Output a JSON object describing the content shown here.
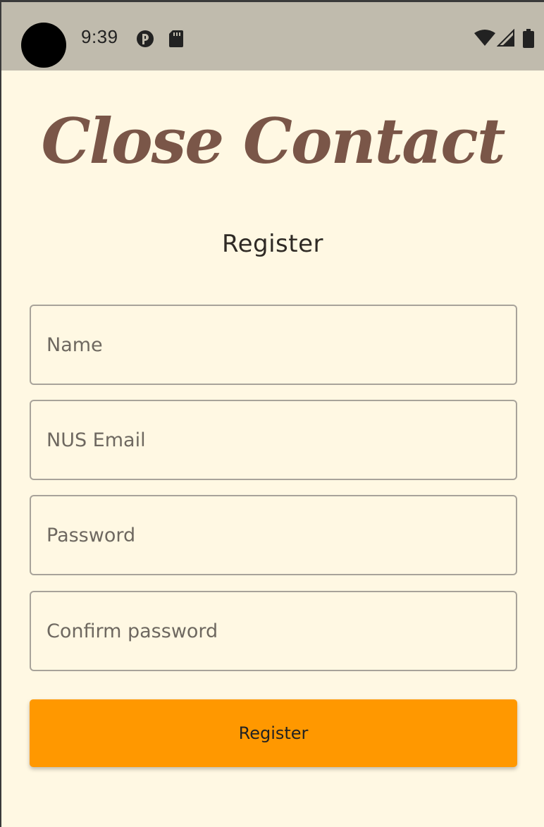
{
  "status_bar": {
    "time": "9:39",
    "icons": [
      "data-saver-icon",
      "sd-card-icon",
      "wifi-icon",
      "cell-signal-icon",
      "battery-icon"
    ]
  },
  "app": {
    "logo_text": "Close Contact",
    "logo_color": "#7a5648"
  },
  "form": {
    "title": "Register",
    "fields": {
      "name": {
        "value": "",
        "placeholder": "Name"
      },
      "email": {
        "value": "",
        "placeholder": "NUS Email"
      },
      "password": {
        "value": "",
        "placeholder": "Password"
      },
      "confirm_password": {
        "value": "",
        "placeholder": "Confirm password"
      }
    },
    "submit_label": "Register",
    "submit_color": "#ff9800"
  },
  "colors": {
    "background": "#fff8e3",
    "status_bar": "#c0bbad"
  }
}
